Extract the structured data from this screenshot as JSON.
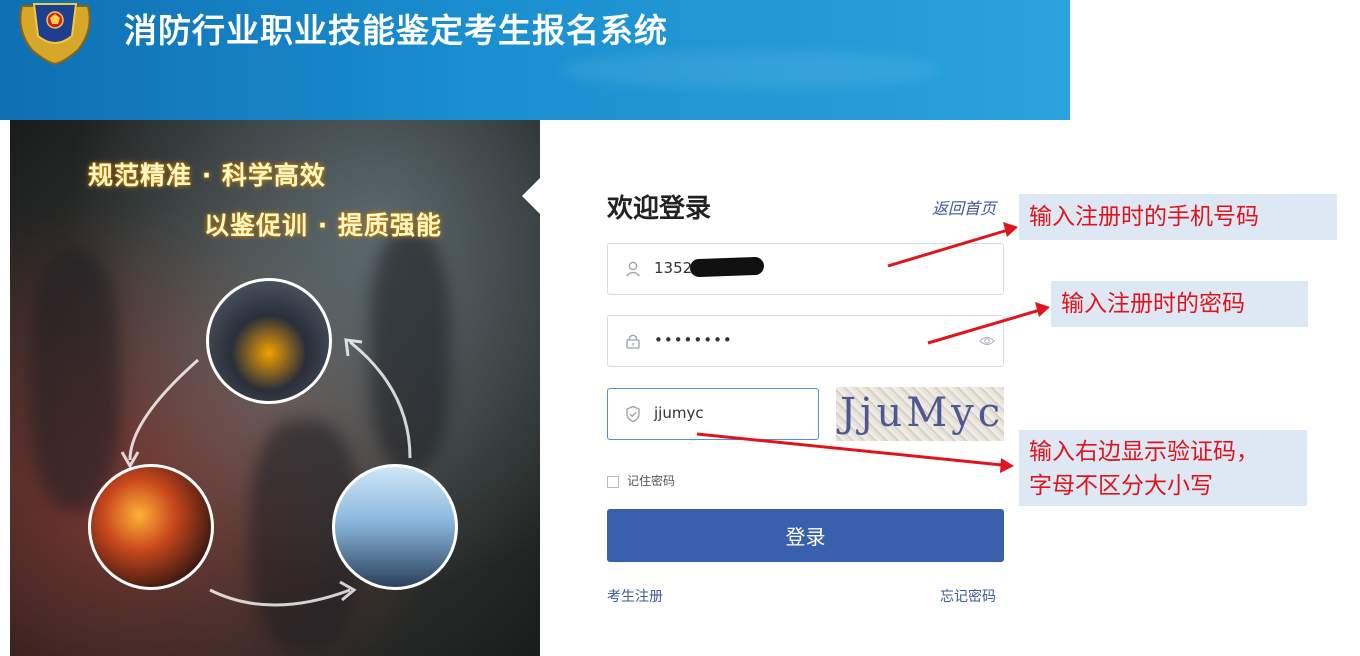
{
  "header": {
    "title": "消防行业职业技能鉴定考生报名系统",
    "emblem": "fire-rescue-emblem"
  },
  "hero": {
    "slogan_line1": "规范精准 · 科学高效",
    "slogan_line2": "以鉴促训 · 提质强能"
  },
  "login": {
    "welcome": "欢迎登录",
    "back_home": "返回首页",
    "phone_value": "1352",
    "password_value": "••••••••",
    "captcha_value": "jjumyc",
    "captcha_image_text": "JjuMyc",
    "remember_label": "记住密码",
    "submit_label": "登录",
    "register_label": "考生注册",
    "forgot_label": "忘记密码"
  },
  "annotations": {
    "phone_note": "输入注册时的手机号码",
    "password_note": "输入注册时的密码",
    "captcha_note_line1": "输入右边显示验证码，",
    "captcha_note_line2": "字母不区分大小写"
  },
  "colors": {
    "header_blue": "#1a8fd0",
    "button_blue": "#3960ad",
    "link_blue": "#3a5a9c",
    "annotation_red": "#e0141c",
    "annotation_bg": "#dde8f4"
  }
}
